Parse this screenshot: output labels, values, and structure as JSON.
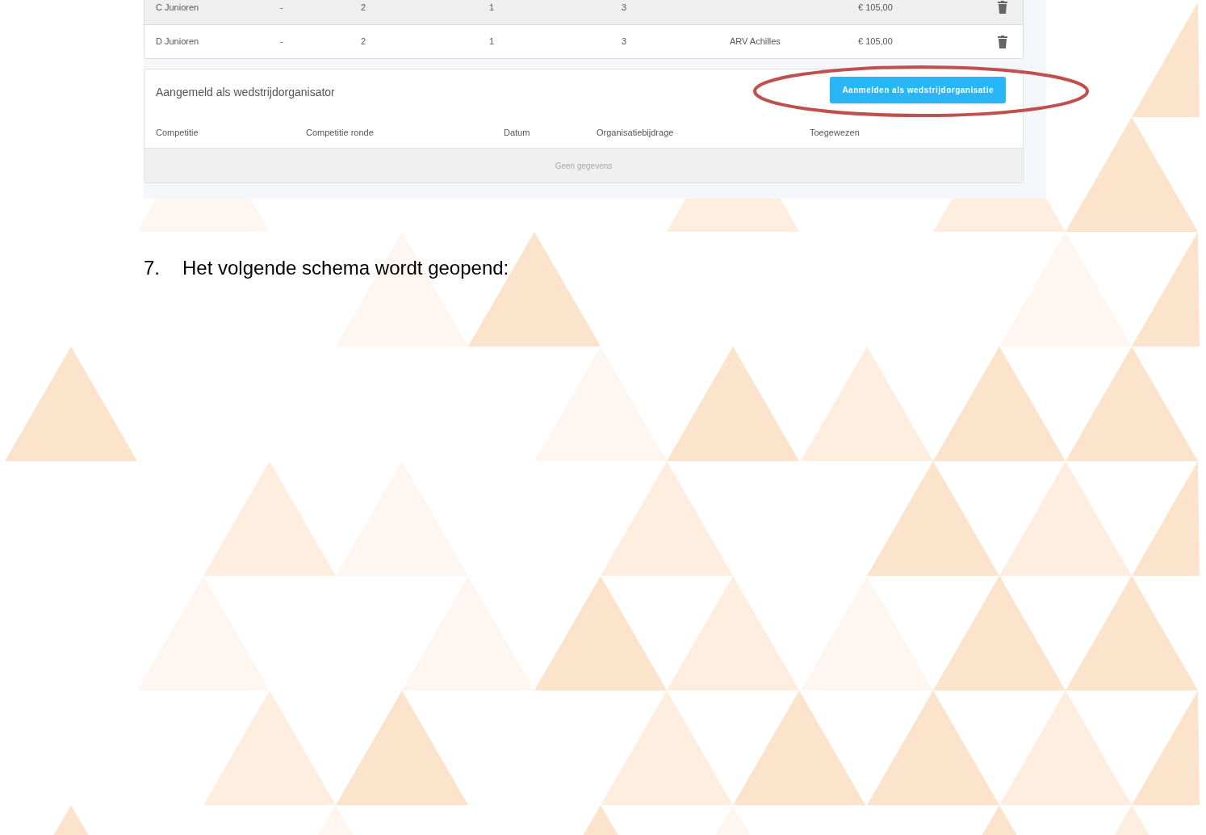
{
  "fees_table": {
    "rows": [
      {
        "cells": [
          "C Junioren",
          "-",
          "2",
          "1",
          "3",
          "",
          "€ 105,00"
        ],
        "shaded": true
      },
      {
        "cells": [
          "D Junioren",
          "-",
          "2",
          "1",
          "3",
          "ARV Achilles",
          "€ 105,00"
        ],
        "shaded": false
      }
    ]
  },
  "organizer_panel": {
    "title": "Aangemeld als wedstrijdorganisator",
    "button": "Aanmelden als wedstrijdorganisatie",
    "columns": [
      "Competitie",
      "Competitie ronde",
      "Datum",
      "Organisatiebijdrage",
      "Toegewezen"
    ],
    "empty_text": "Geen gegevens"
  },
  "step": {
    "number": "7.",
    "text": "Het volgende schema wordt geopend:"
  }
}
